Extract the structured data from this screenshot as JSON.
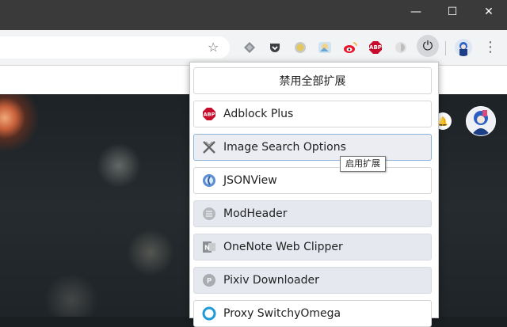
{
  "window": {
    "minimize_glyph": "—",
    "maximize_glyph": "☐",
    "close_glyph": "✕"
  },
  "toolbar": {
    "extension_icons": [
      "layers-extension-icon",
      "pocket-extension-icon",
      "coin-extension-icon",
      "app-extension-icon",
      "weibo-extension-icon",
      "adblock-plus-extension-icon",
      "onenote-extension-icon",
      "power-extension-icon"
    ],
    "abp_icon_text": "ABP"
  },
  "popup": {
    "disable_all_label": "禁用全部扩展",
    "items": [
      {
        "label": "Adblock Plus",
        "enabled": true,
        "icon": "adblock-plus-icon"
      },
      {
        "label": "Image Search Options",
        "enabled": true,
        "icon": "image-search-options-icon"
      },
      {
        "label": "JSONView",
        "enabled": true,
        "icon": "jsonview-icon"
      },
      {
        "label": "ModHeader",
        "enabled": false,
        "icon": "modheader-icon"
      },
      {
        "label": "OneNote Web Clipper",
        "enabled": false,
        "icon": "onenote-icon"
      },
      {
        "label": "Pixiv Downloader",
        "enabled": false,
        "icon": "pixiv-downloader-icon"
      },
      {
        "label": "Proxy SwitchyOmega",
        "enabled": true,
        "icon": "proxy-switchyomega-icon"
      }
    ],
    "tooltip": "启用扩展"
  },
  "colors": {
    "abp_red": "#c70d2c",
    "disabled_row_bg": "#e6e8f0",
    "hover_border": "#8fb2d8"
  }
}
